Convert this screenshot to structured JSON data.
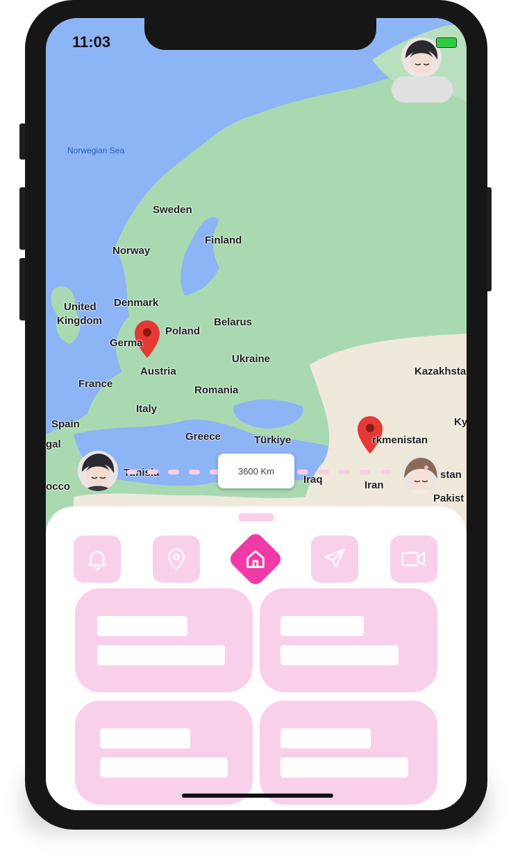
{
  "status_bar": {
    "time": "11:03"
  },
  "map": {
    "labels": {
      "norwegian_sea": "Norwegian Sea",
      "sweden": "Sweden",
      "finland": "Finland",
      "norway": "Norway",
      "denmark": "Denmark",
      "united_kingdom_1": "United",
      "united_kingdom_2": "Kingdom",
      "poland": "Poland",
      "belarus": "Belarus",
      "germany": "Germa",
      "ukraine": "Ukraine",
      "austria": "Austria",
      "france": "France",
      "romania": "Romania",
      "kazakhstan": "Kazakhsta",
      "italy": "Italy",
      "spain": "Spain",
      "greece": "Greece",
      "turkiye": "Türkiye",
      "turkmenistan": "rkmenistan",
      "ky": "Ky",
      "gal": "gal",
      "tunisia": "Tunisia",
      "iraq": "Iraq",
      "istan": "stan",
      "occo": "occo",
      "iran": "Iran",
      "pakist": "Pakist"
    },
    "distance_label": "3600 Km",
    "colors": {
      "water": "#8db4f5",
      "land": "#a9d9b1",
      "pin": "#e53935"
    }
  },
  "sheet": {
    "nav_items": [
      {
        "name": "notifications",
        "icon": "bell-icon"
      },
      {
        "name": "location",
        "icon": "map-pin-icon"
      },
      {
        "name": "home",
        "icon": "home-icon",
        "active": true
      },
      {
        "name": "send",
        "icon": "send-icon"
      },
      {
        "name": "video",
        "icon": "video-icon"
      }
    ],
    "colors": {
      "accent": "#f03aa7",
      "pink_light": "#f9d0ea"
    }
  }
}
